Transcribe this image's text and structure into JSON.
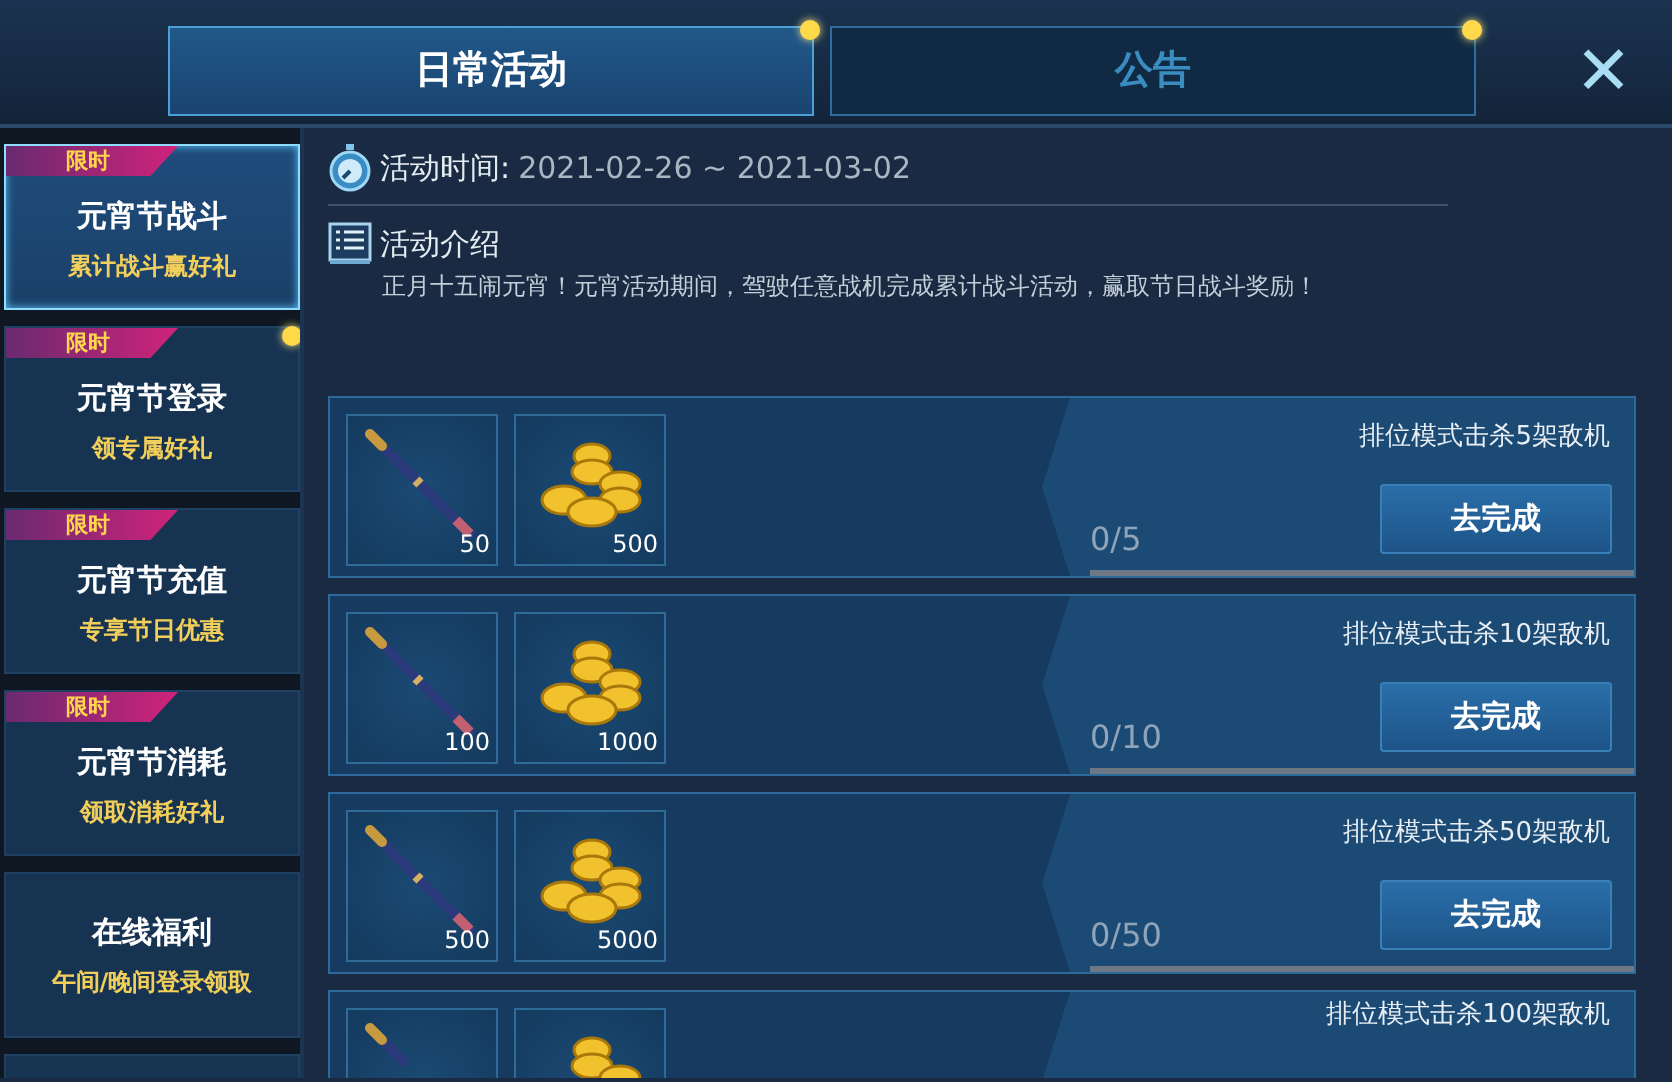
{
  "tabs": [
    {
      "label": "日常活动",
      "selected": true,
      "dot": true
    },
    {
      "label": "公告",
      "selected": false,
      "dot": true
    }
  ],
  "close": "✕",
  "sidebar": {
    "items": [
      {
        "tag": "限时",
        "title": "元宵节战斗",
        "subtitle": "累计战斗赢好礼",
        "selected": true,
        "dot": false
      },
      {
        "tag": "限时",
        "title": "元宵节登录",
        "subtitle": "领专属好礼",
        "selected": false,
        "dot": true
      },
      {
        "tag": "限时",
        "title": "元宵节充值",
        "subtitle": "专享节日优惠",
        "selected": false,
        "dot": false
      },
      {
        "tag": "限时",
        "title": "元宵节消耗",
        "subtitle": "领取消耗好礼",
        "selected": false,
        "dot": false
      },
      {
        "title": "在线福利",
        "subtitle": "午间/晚间登录领取",
        "selected": false,
        "dot": false
      },
      {
        "selected": false
      }
    ]
  },
  "info": {
    "time_label": "活动时间:",
    "time_value": "2021-02-26 ~ 2021-03-02",
    "intro_label": "活动介绍",
    "intro_text": "正月十五闹元宵！元宵活动期间，驾驶任意战机完成累计战斗活动，赢取节日战斗奖励！"
  },
  "tasks": [
    {
      "rewards": [
        {
          "kind": "missile",
          "count": "50"
        },
        {
          "kind": "coins",
          "count": "500"
        }
      ],
      "title": "排位模式击杀5架敌机",
      "progress": "0/5",
      "level": 0,
      "button": "去完成"
    },
    {
      "rewards": [
        {
          "kind": "missile",
          "count": "100"
        },
        {
          "kind": "coins",
          "count": "1000"
        }
      ],
      "title": "排位模式击杀10架敌机",
      "progress": "0/10",
      "level": 0,
      "button": "去完成"
    },
    {
      "rewards": [
        {
          "kind": "missile",
          "count": "500"
        },
        {
          "kind": "coins",
          "count": "5000"
        }
      ],
      "title": "排位模式击杀50架敌机",
      "progress": "0/50",
      "level": 0,
      "button": "去完成"
    },
    {
      "rewards": [
        {
          "kind": "missile"
        },
        {
          "kind": "coins"
        }
      ],
      "title": "排位模式击杀100架敌机"
    }
  ]
}
